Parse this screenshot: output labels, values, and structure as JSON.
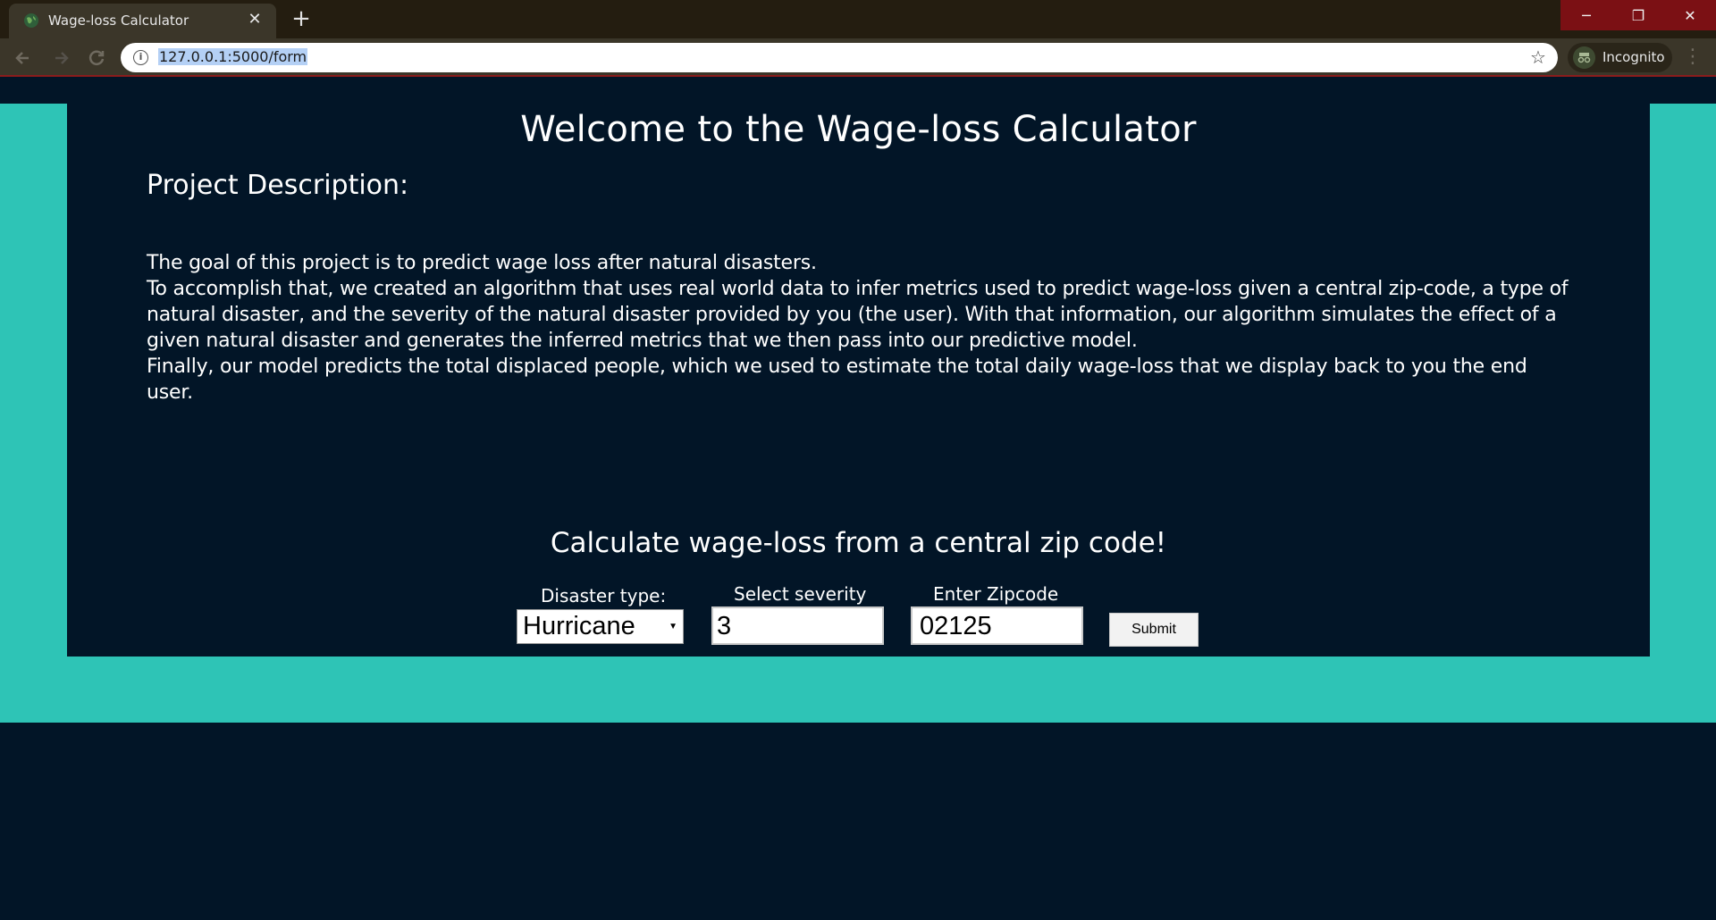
{
  "browser": {
    "tab_title": "Wage-loss Calculator",
    "tab_close": "✕",
    "new_tab": "+",
    "url": "127.0.0.1:5000/form",
    "incognito_label": "Incognito",
    "window_controls": [
      "─",
      "❐",
      "✕"
    ]
  },
  "page": {
    "title": "Welcome to the Wage-loss Calculator",
    "section_heading": "Project Description:",
    "description": [
      "The goal of this project is to predict wage loss after natural disasters.",
      "To accomplish that, we created an algorithm that uses real world data to infer metrics used to predict wage-loss given a central zip-code, a type of natural disaster, and the severity of the natural disaster provided by you (the user). With that information, our algorithm simulates the effect of a given natural disaster and generates the inferred metrics that we then pass into our predictive model.",
      "Finally, our model predicts the total displaced people, which we used to estimate the total daily wage-loss that we display back to you the end user."
    ],
    "calc_heading": "Calculate wage-loss from a central zip code!"
  },
  "form": {
    "disaster_label": "Disaster type:",
    "disaster_value": "Hurricane",
    "severity_label": "Select severity",
    "severity_value": "3",
    "zip_label": "Enter Zipcode",
    "zip_value": "02125",
    "submit_label": "Submit"
  },
  "colors": {
    "teal": "#2ec4b6",
    "navy": "#021527",
    "chrome_dark": "#241d10",
    "chrome_toolbar": "#3b3629",
    "close_red": "#7b1014"
  },
  "icons": {
    "favicon": "globe-favicon-icon",
    "back": "back-arrow-icon",
    "forward": "forward-arrow-icon",
    "reload": "reload-icon",
    "info": "info-icon",
    "star": "bookmark-star-icon",
    "incognito": "incognito-icon",
    "menu": "menu-dots-icon"
  }
}
